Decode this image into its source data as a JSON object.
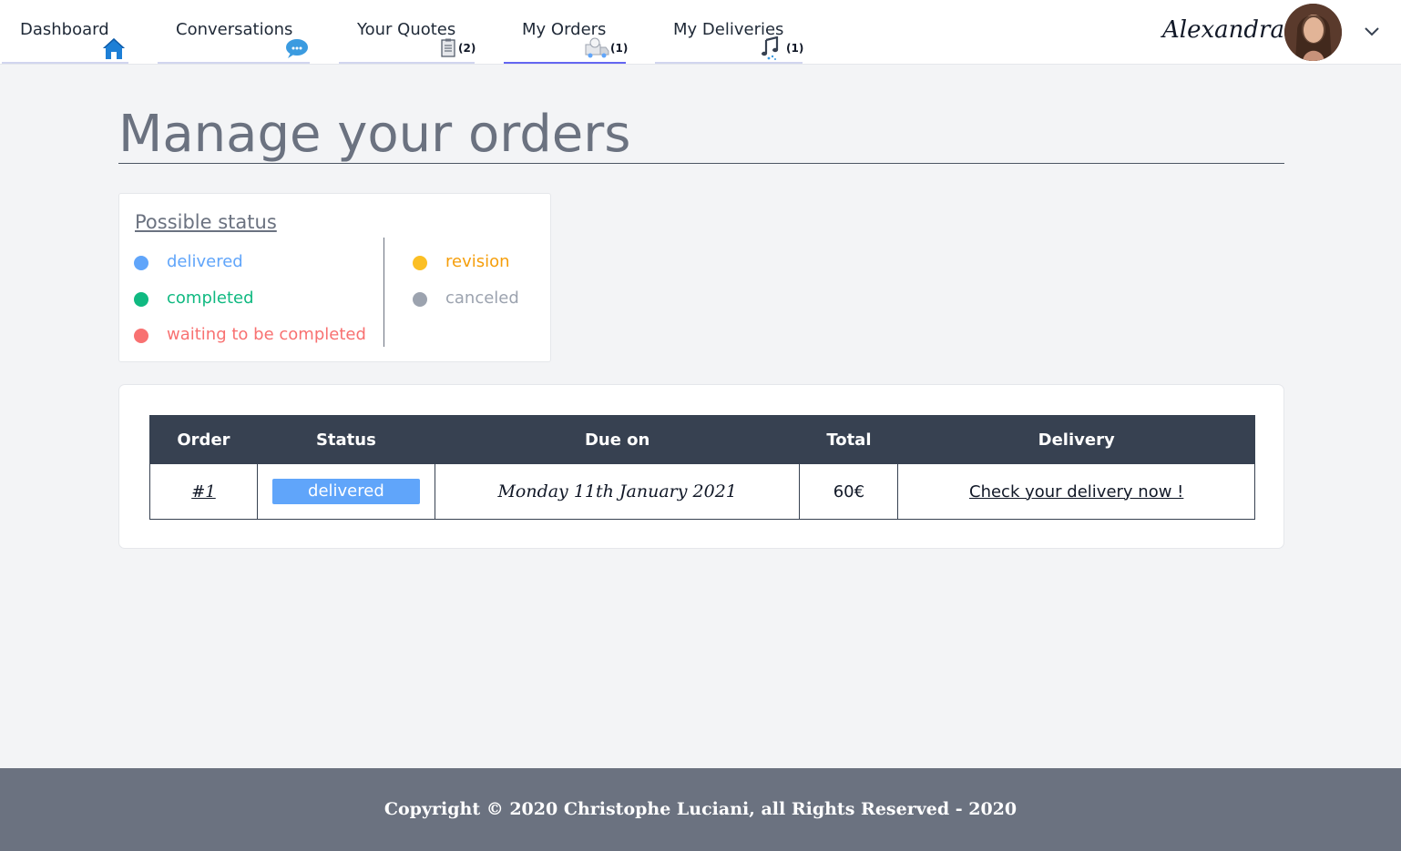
{
  "nav": {
    "items": [
      {
        "label": "Dashboard",
        "icon": "home-icon",
        "count": ""
      },
      {
        "label": "Conversations",
        "icon": "chat-icon",
        "count": ""
      },
      {
        "label": "Your Quotes",
        "icon": "document-icon",
        "count": "(2)"
      },
      {
        "label": "My Orders",
        "icon": "order-icon",
        "count": "(1)"
      },
      {
        "label": "My Deliveries",
        "icon": "music-note-icon",
        "count": "(1)"
      }
    ],
    "active": "My Orders"
  },
  "user": {
    "name": "Alexandra",
    "avatar": "avatar",
    "menu_icon": "chevron-down-icon"
  },
  "page": {
    "title": "Manage your orders"
  },
  "legend": {
    "title": "Possible status",
    "items": [
      {
        "label": "delivered",
        "color": "#60a5fa"
      },
      {
        "label": "completed",
        "color": "#10b981"
      },
      {
        "label": "waiting to be completed",
        "color": "#f87171"
      },
      {
        "label": "revision",
        "color": "#fbbf24"
      },
      {
        "label": "canceled",
        "color": "#9ca3af"
      }
    ]
  },
  "table": {
    "headers": [
      "Order",
      "Status",
      "Due on",
      "Total",
      "Delivery"
    ],
    "rows": [
      {
        "order": "#1",
        "status": "delivered",
        "due": "Monday 11th January 2021",
        "total": "60€",
        "delivery": "Check your delivery now !"
      }
    ]
  },
  "footer": {
    "text": "Copyright © 2020 Christophe Luciani, all Rights Reserved - 2020"
  }
}
